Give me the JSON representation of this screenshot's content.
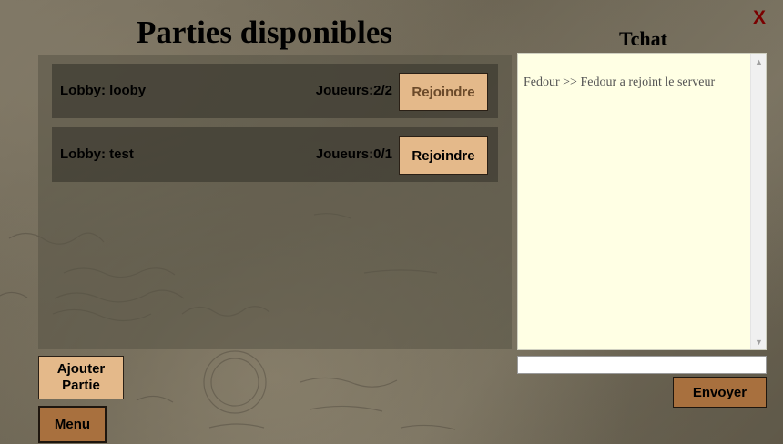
{
  "header": {
    "title": "Parties disponibles",
    "close_label": "X",
    "chat_title": "Tchat"
  },
  "lobbies": [
    {
      "name": "Lobby: looby",
      "players": "Joueurs:2/2",
      "join_label": "Rejoindre"
    },
    {
      "name": "Lobby: test",
      "players": "Joueurs:0/1",
      "join_label": "Rejoindre"
    }
  ],
  "chat": {
    "messages": [
      "Fedour >> Fedour a rejoint le serveur"
    ],
    "input_value": "",
    "send_label": "Envoyer"
  },
  "footer": {
    "add_game_label": "Ajouter\nPartie",
    "menu_label": "Menu"
  },
  "colors": {
    "button_light": "#e4b98a",
    "button_dark": "#a8703e",
    "chat_bg": "#ffffe4",
    "close_color": "#7a0000"
  }
}
